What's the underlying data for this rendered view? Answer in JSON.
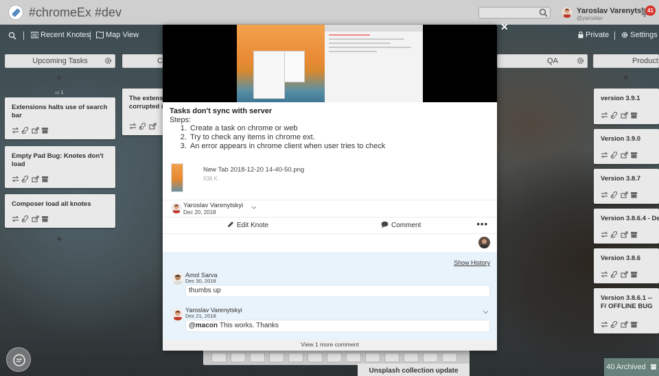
{
  "header": {
    "pad_title": "#chromeEx #dev",
    "search": {
      "value": "",
      "placeholder": ""
    },
    "user": {
      "name": "Yaroslav Varenytskyi",
      "handle": "@yaroslav"
    },
    "notifications_count": "41"
  },
  "toolbar": {
    "recent_knotes": "Recent Knotes",
    "map_view": "Map View",
    "private": "Private",
    "settings": "Settings"
  },
  "lanes": [
    {
      "name": "Upcoming Tasks"
    },
    {
      "name": "Cu"
    },
    {
      "name": "QA"
    },
    {
      "name": "Product"
    }
  ],
  "upcoming_count": "1",
  "upcoming_knotes": [
    {
      "title": "Extensions halts use of search bar"
    },
    {
      "title": "Empty Pad Bug: Knotes don't load"
    },
    {
      "title": "Composer load all knotes"
    }
  ],
  "second_lane_knote": {
    "title": "The extens corrupted i"
  },
  "product_knotes": [
    {
      "title": "version 3.9.1"
    },
    {
      "title": "Version 3.9.0"
    },
    {
      "title": "Version 3.8.7"
    },
    {
      "title": "Version 3.8.6.4 - De"
    },
    {
      "title": "Version 3.8.6"
    },
    {
      "title": "Version 3.8.6.1 -- F/ OFFLINE BUG"
    }
  ],
  "bottom_knote": "Unsplash collection update",
  "archived": "40 Archived",
  "modal": {
    "task_title": "Tasks don't sync with server",
    "steps_label": "Steps:",
    "steps": [
      "Create a task on chrome or web",
      "Try to check any items in chrome ext.",
      "An error appears in chrome client when user tries to check"
    ],
    "attachment": {
      "file_name": "New Tab 2018-12-20 14-40-50.png",
      "size": "938 K"
    },
    "author": {
      "name": "Yaroslav Varenytskyi",
      "date": "Dec 20, 2018"
    },
    "edit_label": "Edit Knote",
    "comment_label": "Comment",
    "show_history": "Show History",
    "comments": [
      {
        "author": "Amol Sarva",
        "date": "Dec 30, 2018",
        "mention": "",
        "text": "thumbs up"
      },
      {
        "author": "Yaroslav Varenytskyi",
        "date": "Dec 21, 2018",
        "mention": "@macon",
        "text": "This works. Thanks"
      }
    ],
    "view_more": "View 1 more comment"
  },
  "colors": {
    "notification_badge": "#d9322b",
    "comments_background": "#e8f3fb",
    "archived_background": "#78968c"
  }
}
